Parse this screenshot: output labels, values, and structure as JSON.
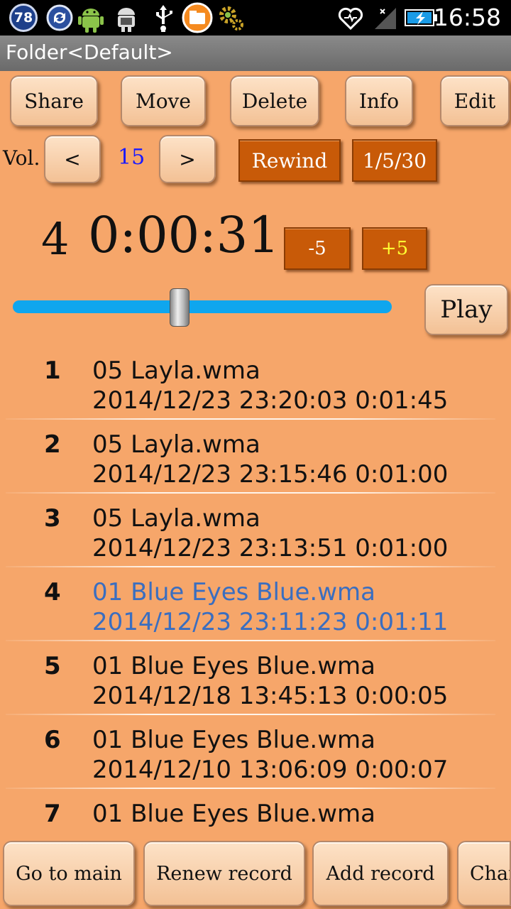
{
  "status_bar": {
    "badge_count": "78",
    "time": "16:58",
    "icons": [
      "notification-count-icon",
      "sync-icon",
      "android-icon",
      "android-debug-icon",
      "usb-icon",
      "folder-app-icon",
      "settings-gear-icon",
      "heart-icon",
      "signal-icon",
      "battery-charging-icon"
    ]
  },
  "title": "Folder<Default>",
  "toolbar": {
    "share": "Share",
    "move": "Move",
    "delete": "Delete",
    "info": "Info",
    "edit": "Edit"
  },
  "volume": {
    "label": "Vol.",
    "decrease": "<",
    "value": "15",
    "increase": ">"
  },
  "rewind": "Rewind",
  "speed": "1/5/30",
  "player": {
    "track_number": "4",
    "position": "0:00:31",
    "back5": "-5",
    "forward5": "+5",
    "play": "Play",
    "progress": 0.44
  },
  "records": [
    {
      "num": "1",
      "name": "05 Layla.wma",
      "meta": "2014/12/23 23:20:03 0:01:45",
      "selected": false
    },
    {
      "num": "2",
      "name": "05 Layla.wma",
      "meta": "2014/12/23 23:15:46 0:01:00",
      "selected": false
    },
    {
      "num": "3",
      "name": "05 Layla.wma",
      "meta": "2014/12/23 23:13:51 0:01:00",
      "selected": false
    },
    {
      "num": "4",
      "name": "01 Blue Eyes Blue.wma",
      "meta": "2014/12/23 23:11:23 0:01:11",
      "selected": true
    },
    {
      "num": "5",
      "name": "01 Blue Eyes Blue.wma",
      "meta": "2014/12/18 13:45:13 0:00:05",
      "selected": false
    },
    {
      "num": "6",
      "name": "01 Blue Eyes Blue.wma",
      "meta": "2014/12/10 13:06:09 0:00:07",
      "selected": false
    },
    {
      "num": "7",
      "name": "01 Blue Eyes Blue.wma",
      "meta": "",
      "selected": false
    }
  ],
  "bottom": {
    "go_main": "Go to main",
    "renew": "Renew record",
    "add": "Add record",
    "change": "Char"
  },
  "colors": {
    "background": "#f6a66a",
    "dark_button": "#c85a08",
    "selected_text": "#3a6ec0",
    "volume_value": "#1a1aff",
    "plus_text": "#ffff33",
    "slider": "#0fa6ee"
  }
}
